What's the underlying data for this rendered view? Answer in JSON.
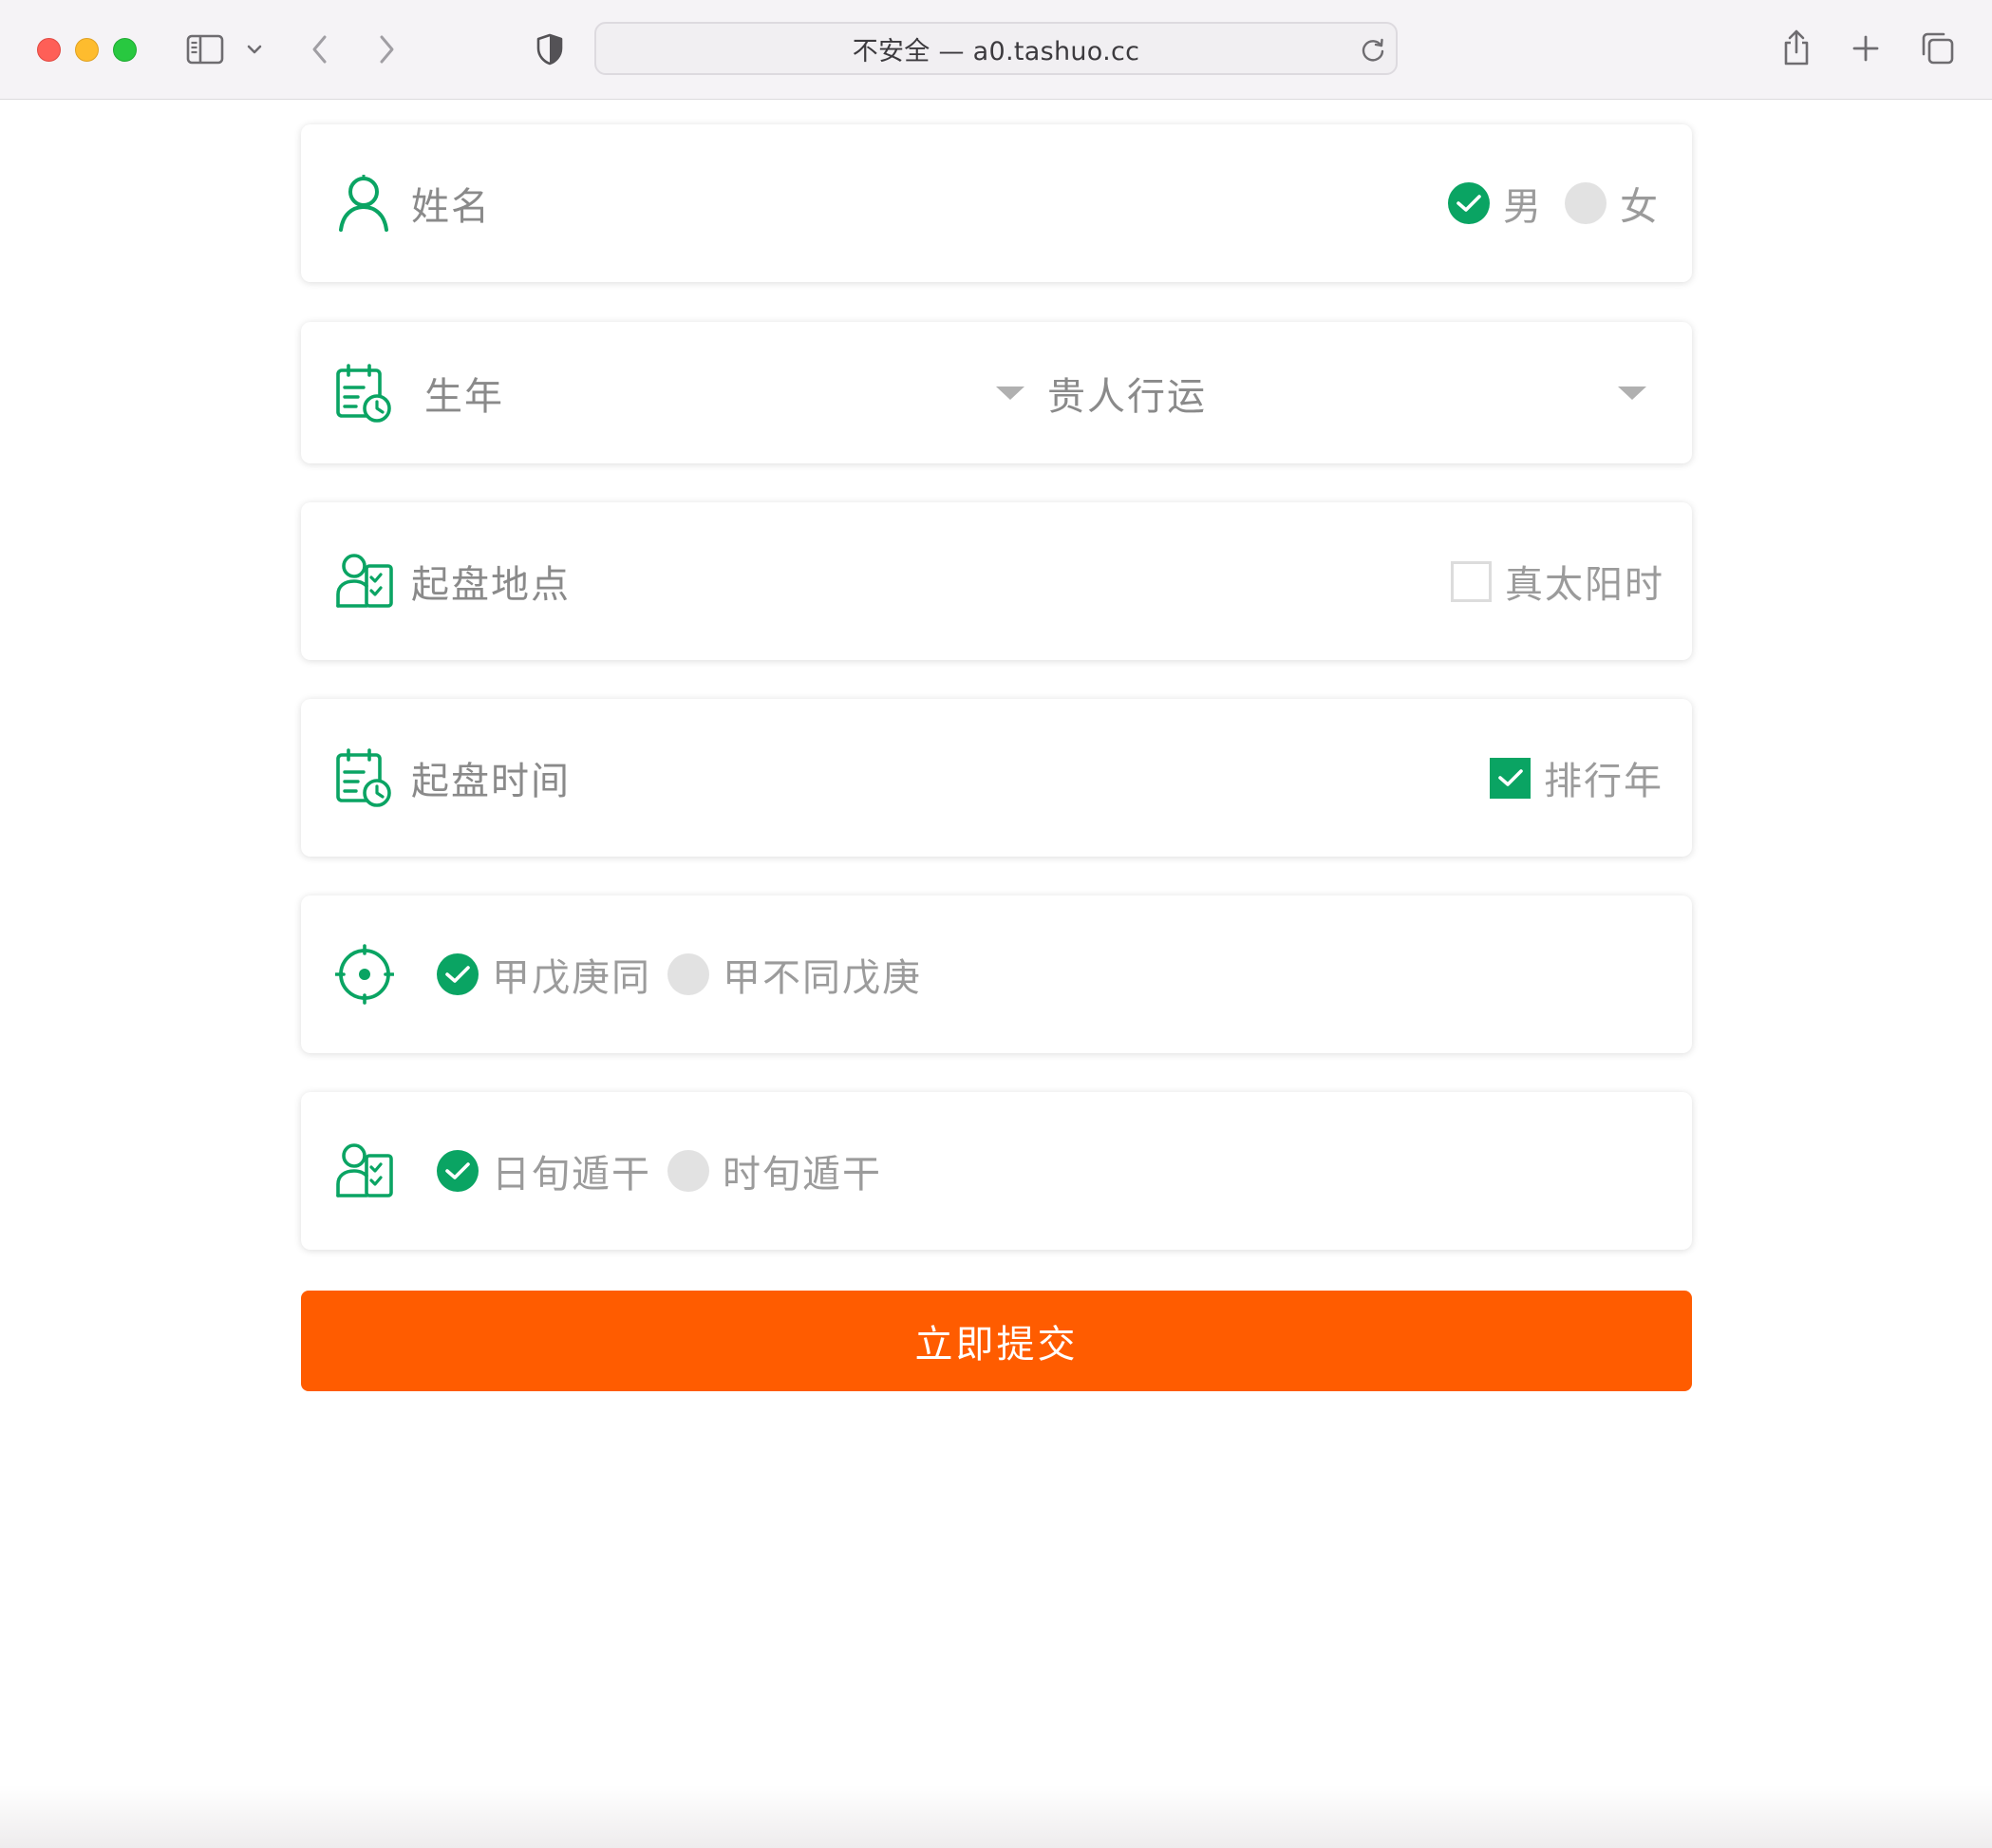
{
  "browser": {
    "url_text": "不安全 — a0.tashuo.cc"
  },
  "form": {
    "name": {
      "placeholder": "姓名",
      "gender_options": [
        {
          "label": "男",
          "selected": true
        },
        {
          "label": "女",
          "selected": false
        }
      ]
    },
    "birth": {
      "year_placeholder": "生年",
      "mode_value": "贵人行运"
    },
    "place": {
      "placeholder": "起盘地点",
      "true_solar_time": {
        "label": "真太阳时",
        "checked": false
      }
    },
    "time": {
      "placeholder": "起盘时间",
      "sort_year": {
        "label": "排行年",
        "checked": true
      }
    },
    "jia_option": {
      "options": [
        {
          "label": "甲戊庚同",
          "selected": true
        },
        {
          "label": "甲不同戊庚",
          "selected": false
        }
      ]
    },
    "xun_option": {
      "options": [
        {
          "label": "日旬遁干",
          "selected": true
        },
        {
          "label": "时旬遁干",
          "selected": false
        }
      ]
    },
    "submit_label": "立即提交"
  },
  "colors": {
    "accent_green": "#0aa463",
    "submit_orange": "#ff5c00",
    "label_gray": "#8a8a8a"
  },
  "icons": {
    "name": "user-icon",
    "birth": "calendar-clock-icon",
    "place": "id-card-icon",
    "time": "calendar-clock-icon",
    "jia": "crosshair-icon",
    "xun": "id-card-icon"
  }
}
